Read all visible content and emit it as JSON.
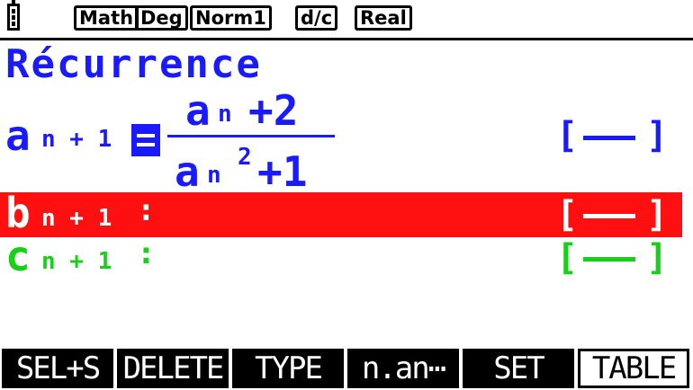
{
  "status_bar": {
    "battery_icon": "battery-icon",
    "modes": [
      "Math",
      "Deg",
      "Norm1",
      "d/c",
      "Real"
    ]
  },
  "screen_title": "Récurrence",
  "rows": [
    {
      "name": "a",
      "lhs_letter": "a",
      "lhs_subscript": "n + 1",
      "numerator_letter": "a",
      "numerator_subscript": "n",
      "numerator_rest": "+2",
      "denominator_letter": "a",
      "denominator_subscript": "n",
      "denominator_exponent": "2",
      "denominator_rest": "+1",
      "style_bracket_open": "[",
      "style_bracket_close": "]",
      "color": "#1a1aff"
    },
    {
      "name": "b",
      "lhs_letter": "b",
      "lhs_subscript": "n + 1",
      "separator": ":",
      "style_bracket_open": "[",
      "style_bracket_close": "]",
      "selected": true,
      "color": "#ffffff",
      "highlight": "#ff1010"
    },
    {
      "name": "c",
      "lhs_letter": "c",
      "lhs_subscript": "n + 1",
      "separator": ":",
      "style_bracket_open": "[",
      "style_bracket_close": "]",
      "color": "#18d018"
    }
  ],
  "function_keys": [
    "SEL+S",
    "DELETE",
    "TYPE",
    "n.an⋯",
    "SET",
    "TABLE"
  ]
}
